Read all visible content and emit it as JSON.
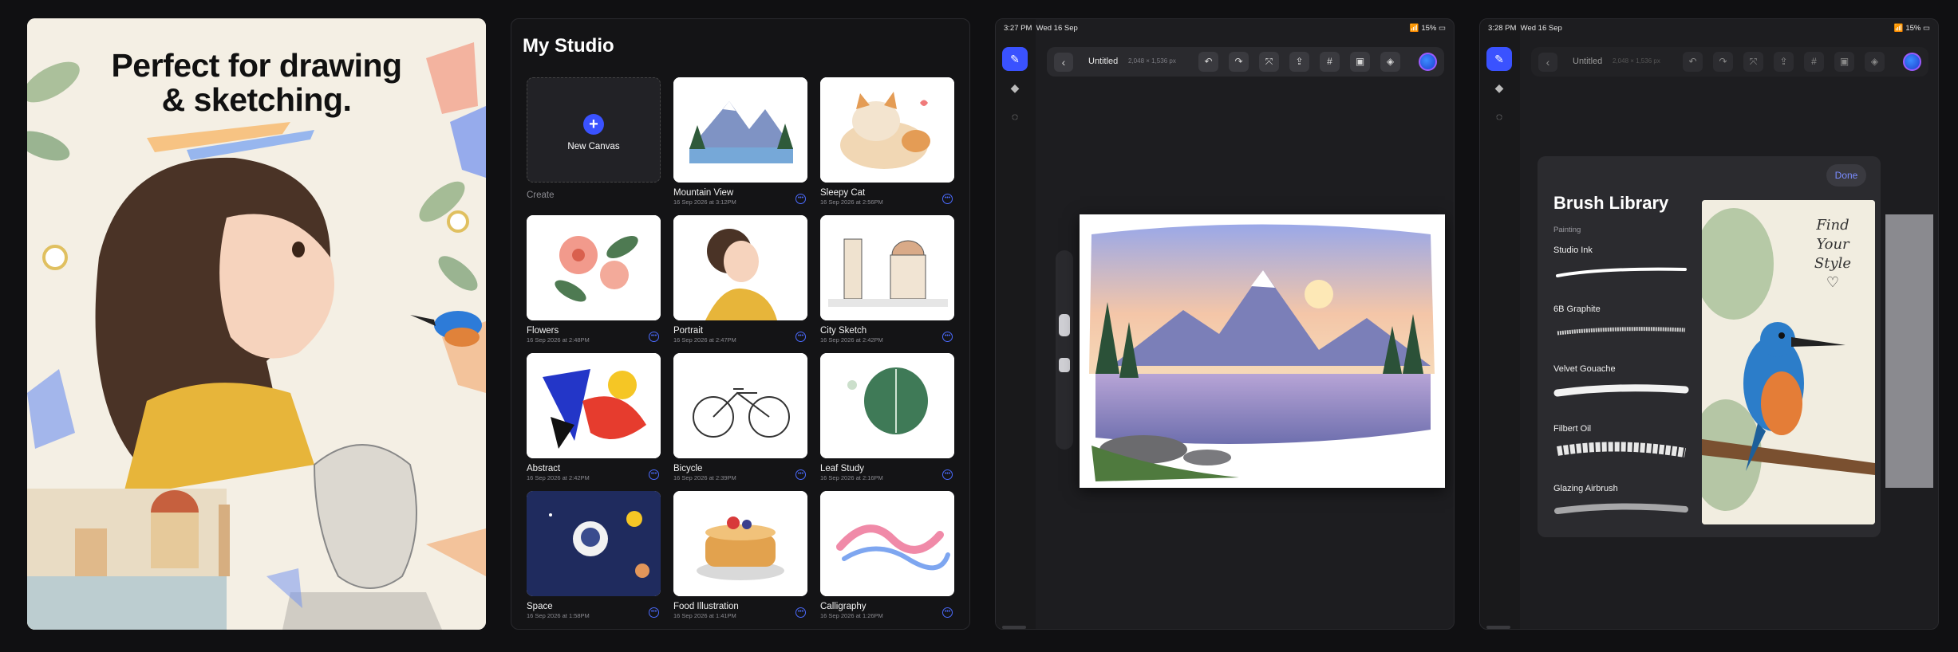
{
  "panel1": {
    "headline_line1": "Perfect for drawing",
    "headline_line2": "& sketching."
  },
  "studio": {
    "title": "My Studio",
    "new_canvas_label": "New Canvas",
    "create_label": "Create",
    "artworks": [
      {
        "name": "Mountain View",
        "date": "16 Sep 2026 at 3:12PM"
      },
      {
        "name": "Sleepy Cat",
        "date": "16 Sep 2026 at 2:56PM"
      },
      {
        "name": "Flowers",
        "date": "16 Sep 2026 at 2:48PM"
      },
      {
        "name": "Portrait",
        "date": "16 Sep 2026 at 2:47PM"
      },
      {
        "name": "City Sketch",
        "date": "16 Sep 2026 at 2:42PM"
      },
      {
        "name": "Abstract",
        "date": "16 Sep 2026 at 2:42PM"
      },
      {
        "name": "Bicycle",
        "date": "16 Sep 2026 at 2:39PM"
      },
      {
        "name": "Leaf Study",
        "date": "16 Sep 2026 at 2:16PM"
      },
      {
        "name": "Space",
        "date": "16 Sep 2026 at 1:58PM"
      },
      {
        "name": "Food Illustration",
        "date": "16 Sep 2026 at 1:41PM"
      },
      {
        "name": "Calligraphy",
        "date": "16 Sep 2026 at 1:26PM"
      }
    ]
  },
  "editor": {
    "time": "3:27 PM",
    "date": "Wed 16 Sep",
    "battery": "15%",
    "doc_title": "Untitled",
    "doc_size": "2,048 × 1,536 px"
  },
  "library": {
    "time": "3:28 PM",
    "date": "Wed 16 Sep",
    "battery": "15%",
    "doc_title": "Untitled",
    "doc_size": "2,048 × 1,536 px",
    "title": "Brush Library",
    "done_label": "Done",
    "category": "Painting",
    "brushes": [
      "Studio Ink",
      "6B Graphite",
      "Velvet Gouache",
      "Filbert Oil",
      "Glazing Airbrush"
    ],
    "preview_text_1": "Find",
    "preview_text_2": "Your",
    "preview_text_3": "Style"
  },
  "colors": {
    "accent": "#3a52ff",
    "background": "#101012"
  }
}
